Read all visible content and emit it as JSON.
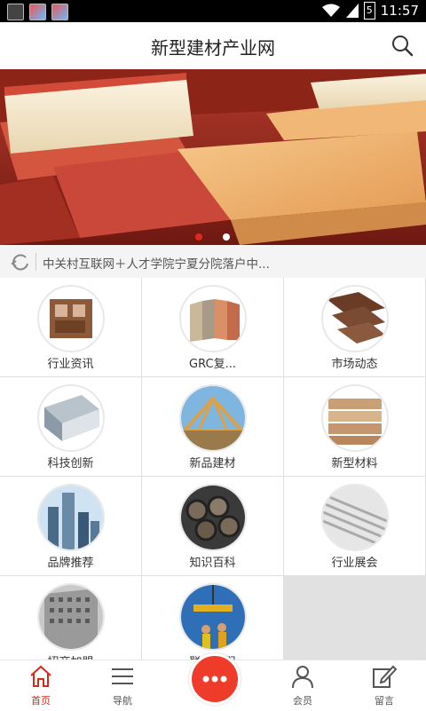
{
  "status_bar": {
    "time": "11:57",
    "battery": "5"
  },
  "header": {
    "title": "新型建材产业网"
  },
  "banner": {
    "active_dot": 0,
    "dots": 2
  },
  "ticker": {
    "text": "中关村互联网＋人才学院宁夏分院落户中..."
  },
  "grid": {
    "items": [
      {
        "label": "行业资讯",
        "icon": "pvc-profile-image"
      },
      {
        "label": "GRC复...",
        "icon": "stone-panels-image"
      },
      {
        "label": "市场动态",
        "icon": "wood-beams-image"
      },
      {
        "label": "科技创新",
        "icon": "insulation-panel-image"
      },
      {
        "label": "新品建材",
        "icon": "roof-frame-image"
      },
      {
        "label": "新型材料",
        "icon": "wood-stack-image"
      },
      {
        "label": "品牌推荐",
        "icon": "skyscrapers-image"
      },
      {
        "label": "知识百科",
        "icon": "steel-pipes-image"
      },
      {
        "label": "行业展会",
        "icon": "metal-sheets-image"
      },
      {
        "label": "招商加盟",
        "icon": "perforated-wall-image"
      },
      {
        "label": "联系我们",
        "icon": "crane-workers-image"
      }
    ]
  },
  "tabbar": {
    "tabs": [
      {
        "label": "首页",
        "icon": "home-icon",
        "active": true
      },
      {
        "label": "导航",
        "icon": "menu-icon",
        "active": false
      },
      {
        "label": "",
        "icon": "more-icon",
        "active": false
      },
      {
        "label": "会员",
        "icon": "user-icon",
        "active": false
      },
      {
        "label": "留言",
        "icon": "edit-icon",
        "active": false
      }
    ]
  },
  "colors": {
    "accent": "#ef3b2a",
    "active_tab": "#d8281c",
    "dot_active": "#e0281c"
  }
}
